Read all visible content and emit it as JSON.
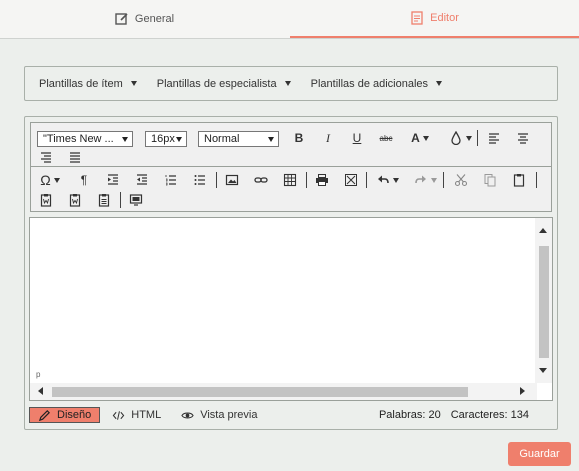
{
  "tabs": {
    "general": "General",
    "editor": "Editor"
  },
  "templates": {
    "items": [
      "Plantillas de ítem",
      "Plantillas de especialista",
      "Plantillas de adicionales"
    ]
  },
  "toolbar": {
    "font_family": "\"Times New ...",
    "font_size": "16px",
    "format": "Normal",
    "bold": "B",
    "italic": "I",
    "underline": "U",
    "strike": "abc",
    "font_color": "A",
    "pilcrow": "¶",
    "special_char": "Ω"
  },
  "status": {
    "design_label": "Diseño",
    "html_label": "HTML",
    "preview_label": "Vista previa",
    "words": "Palabras: 20",
    "chars": "Caracteres: 134",
    "path_marker": "p"
  },
  "actions": {
    "save_label": "Guardar"
  },
  "colors": {
    "accent": "#ef7f6c",
    "background": "#ecefec"
  }
}
